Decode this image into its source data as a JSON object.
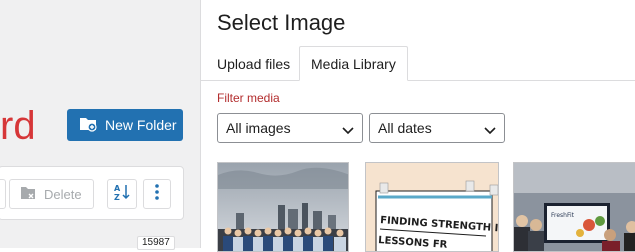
{
  "background": {
    "title_fragment": "rd",
    "new_folder_label": "New Folder",
    "delete_label": "Delete",
    "item_count": "15987",
    "colors": {
      "accent": "#2271b1",
      "title_red": "#d63638"
    }
  },
  "modal": {
    "title": "Select Image",
    "tabs": [
      {
        "label": "Upload files",
        "active": false
      },
      {
        "label": "Media Library",
        "active": true
      }
    ],
    "filter_label": "Filter media",
    "type_filter": {
      "value": "All images"
    },
    "date_filter": {
      "value": "All dates"
    },
    "thumbnails": [
      {
        "name": "group-photo-city-thumbnail"
      },
      {
        "name": "finding-strength-slide-thumbnail",
        "text": "FINDING STRENGTH IN THE C",
        "text2": "LESSONS FR"
      },
      {
        "name": "conference-room-thumbnail",
        "screen_text": "FreshFit"
      }
    ]
  }
}
